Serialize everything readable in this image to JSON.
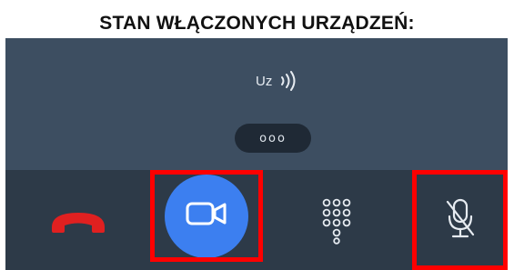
{
  "heading": "STAN WŁĄCZONYCH URZĄDZEŃ:",
  "call": {
    "caller_label": "Uz",
    "more_label": "ooo"
  },
  "toolbar": {
    "buttons": [
      {
        "name": "hangup",
        "icon": "phone-hangup-icon",
        "color": "#e02020"
      },
      {
        "name": "camera",
        "icon": "video-camera-icon",
        "state": "on",
        "color": "#3c7ff0"
      },
      {
        "name": "keypad",
        "icon": "dialpad-icon"
      },
      {
        "name": "microphone",
        "icon": "microphone-off-icon",
        "state": "muted"
      }
    ]
  },
  "colors": {
    "highlight": "#ff0000",
    "panel": "#3d4e61",
    "toolbar": "#2d3a48"
  }
}
